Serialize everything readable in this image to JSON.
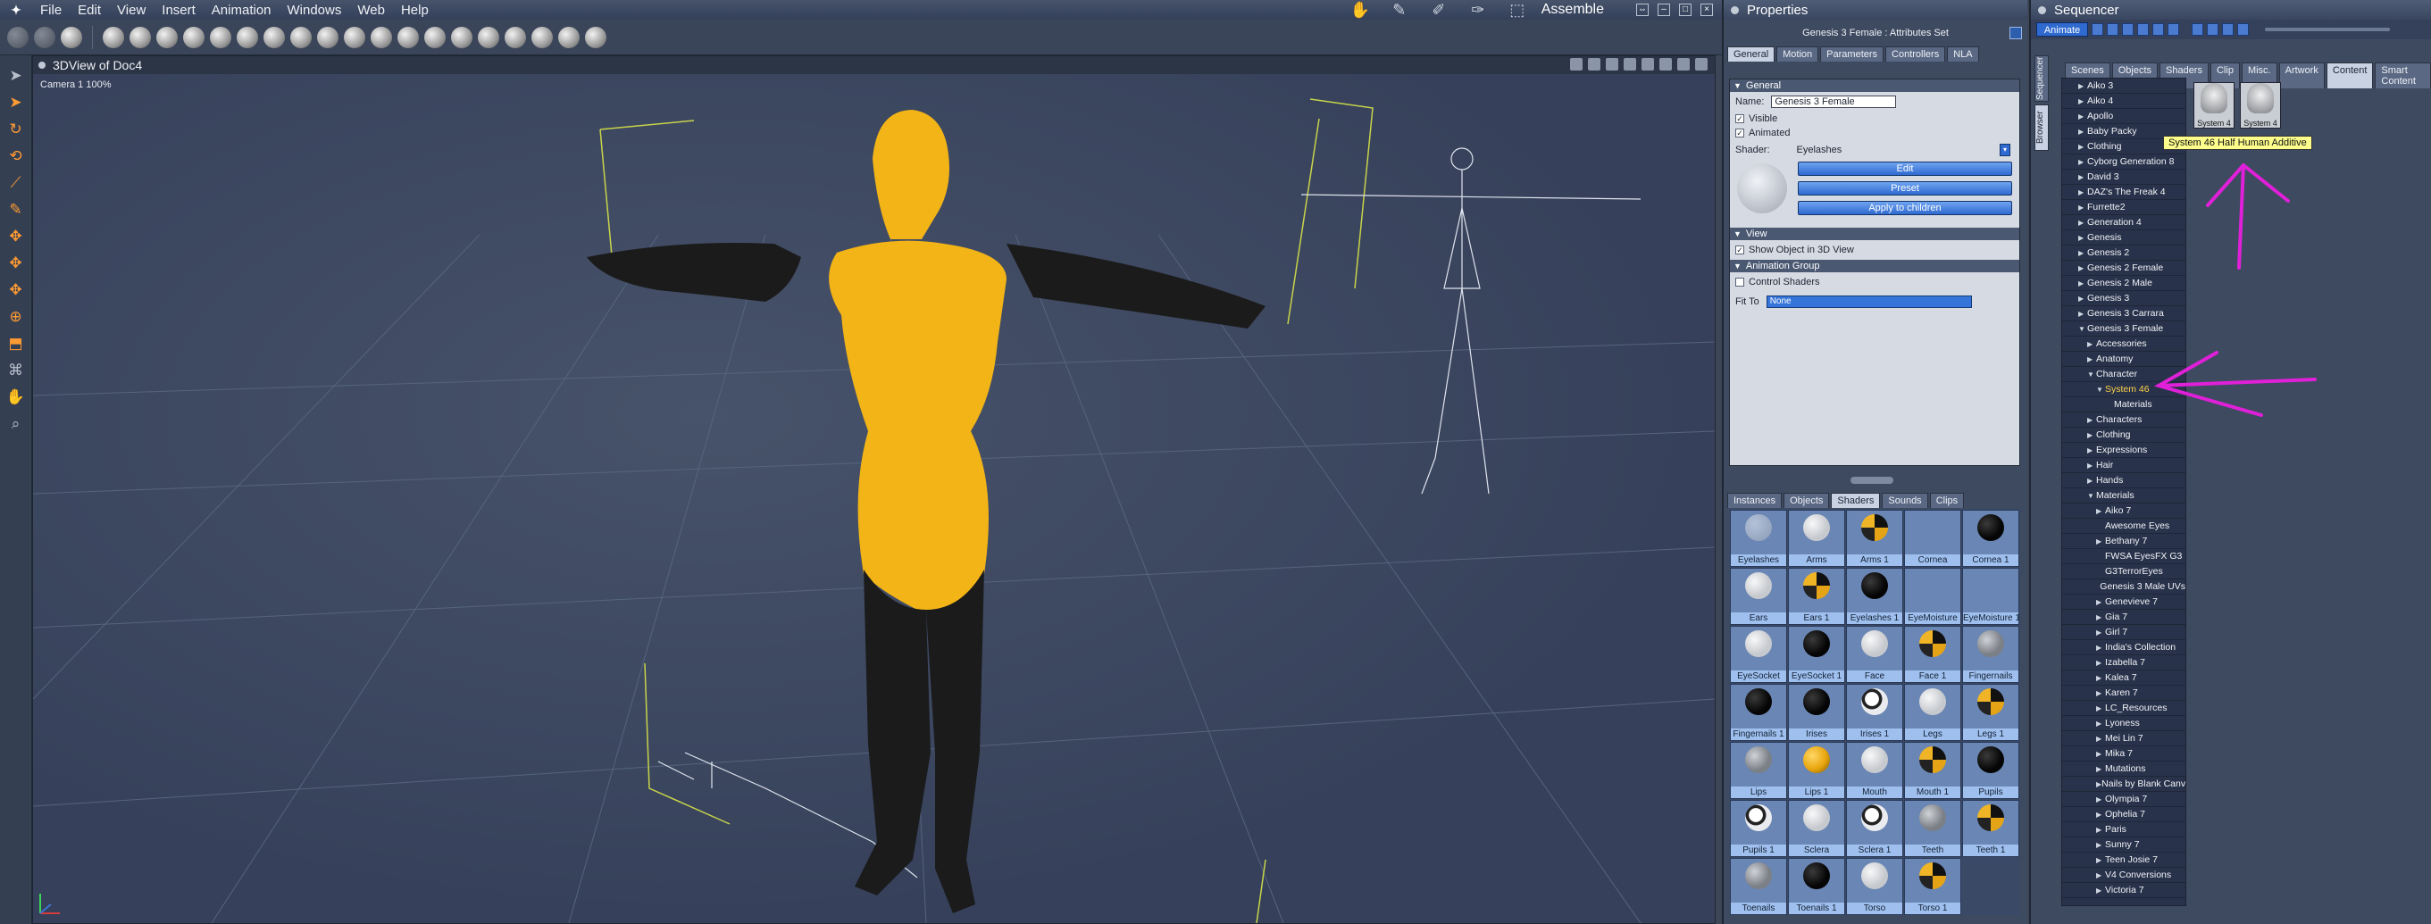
{
  "menubar": {
    "items": [
      "File",
      "Edit",
      "View",
      "Insert",
      "Animation",
      "Windows",
      "Web",
      "Help"
    ],
    "layout_name": "Assemble"
  },
  "viewport": {
    "title": "3DView of Doc4",
    "camera_label": "Camera 1 100%"
  },
  "properties": {
    "panel_title": "Properties",
    "subtitle": "Genesis 3 Female : Attributes Set",
    "tabs": [
      "General",
      "Motion",
      "Parameters",
      "Controllers",
      "NLA"
    ],
    "general_header": "General",
    "name_label": "Name:",
    "name_value": "Genesis 3 Female",
    "visible_label": "Visible",
    "animated_label": "Animated",
    "shader_label": "Shader:",
    "shader_value": "Eyelashes",
    "edit_label": "Edit",
    "preset_label": "Preset",
    "apply_label": "Apply to children",
    "view_header": "View",
    "show_label": "Show Object in 3D View",
    "anim_group_header": "Animation Group",
    "control_shaders_label": "Control Shaders",
    "fit_label": "Fit To",
    "fit_value": "None",
    "bottom_tabs": [
      "Instances",
      "Objects",
      "Shaders",
      "Sounds",
      "Clips"
    ],
    "shaders": [
      {
        "name": "Eyelashes",
        "ball": "faint"
      },
      {
        "name": "Arms",
        "ball": "pale"
      },
      {
        "name": "Arms 1",
        "ball": "mix"
      },
      {
        "name": "Cornea",
        "ball": "none"
      },
      {
        "name": "Cornea 1",
        "ball": "black"
      },
      {
        "name": "Ears",
        "ball": "pale"
      },
      {
        "name": "Ears 1",
        "ball": "mix"
      },
      {
        "name": "Eyelashes 1",
        "ball": "black"
      },
      {
        "name": "EyeMoisture",
        "ball": "none"
      },
      {
        "name": "EyeMoisture 1",
        "ball": "none"
      },
      {
        "name": "EyeSocket",
        "ball": "pale"
      },
      {
        "name": "EyeSocket 1",
        "ball": "black"
      },
      {
        "name": "Face",
        "ball": "pale"
      },
      {
        "name": "Face 1",
        "ball": "mix"
      },
      {
        "name": "Fingernails",
        "ball": "grey"
      },
      {
        "name": "Fingernails 1",
        "ball": "black"
      },
      {
        "name": "Irises",
        "ball": "black"
      },
      {
        "name": "Irises 1",
        "ball": "eye"
      },
      {
        "name": "Legs",
        "ball": "pale"
      },
      {
        "name": "Legs 1",
        "ball": "mix"
      },
      {
        "name": "Lips",
        "ball": "grey"
      },
      {
        "name": "Lips 1",
        "ball": "gold"
      },
      {
        "name": "Mouth",
        "ball": "pale"
      },
      {
        "name": "Mouth 1",
        "ball": "mix"
      },
      {
        "name": "Pupils",
        "ball": "black"
      },
      {
        "name": "Pupils 1",
        "ball": "eye"
      },
      {
        "name": "Sclera",
        "ball": "pale"
      },
      {
        "name": "Sclera 1",
        "ball": "eye"
      },
      {
        "name": "Teeth",
        "ball": "grey"
      },
      {
        "name": "Teeth 1",
        "ball": "mix"
      },
      {
        "name": "Toenails",
        "ball": "grey"
      },
      {
        "name": "Toenails 1",
        "ball": "black"
      },
      {
        "name": "Torso",
        "ball": "pale"
      },
      {
        "name": "Torso 1",
        "ball": "mix"
      }
    ]
  },
  "sequencer": {
    "panel_title": "Sequencer",
    "animate_label": "Animate",
    "vtabs": [
      "Sequencer",
      "Browser"
    ],
    "tabs": [
      "Scenes",
      "Objects",
      "Shaders",
      "Clip",
      "Misc.",
      "Artwork",
      "Content",
      "Smart Content"
    ],
    "tree": [
      {
        "label": "Aiko 3",
        "level": 0,
        "arrow": "▶"
      },
      {
        "label": "Aiko 4",
        "level": 0,
        "arrow": "▶"
      },
      {
        "label": "Apollo",
        "level": 0,
        "arrow": "▶"
      },
      {
        "label": "Baby Packy",
        "level": 0,
        "arrow": "▶"
      },
      {
        "label": "Clothing",
        "level": 0,
        "arrow": "▶"
      },
      {
        "label": "Cyborg Generation 8",
        "level": 0,
        "arrow": "▶"
      },
      {
        "label": "David 3",
        "level": 0,
        "arrow": "▶"
      },
      {
        "label": "DAZ's The Freak 4",
        "level": 0,
        "arrow": "▶"
      },
      {
        "label": "Furrette2",
        "level": 0,
        "arrow": "▶"
      },
      {
        "label": "Generation 4",
        "level": 0,
        "arrow": "▶"
      },
      {
        "label": "Genesis",
        "level": 0,
        "arrow": "▶"
      },
      {
        "label": "Genesis 2",
        "level": 0,
        "arrow": "▶"
      },
      {
        "label": "Genesis 2 Female",
        "level": 0,
        "arrow": "▶"
      },
      {
        "label": "Genesis 2 Male",
        "level": 0,
        "arrow": "▶"
      },
      {
        "label": "Genesis 3",
        "level": 0,
        "arrow": "▶"
      },
      {
        "label": "Genesis 3 Carrara",
        "level": 0,
        "arrow": "▶"
      },
      {
        "label": "Genesis 3 Female",
        "level": 0,
        "arrow": "▼"
      },
      {
        "label": "Accessories",
        "level": 1,
        "arrow": "▶"
      },
      {
        "label": "Anatomy",
        "level": 1,
        "arrow": "▶"
      },
      {
        "label": "Character",
        "level": 1,
        "arrow": "▼"
      },
      {
        "label": "System 46",
        "level": 2,
        "arrow": "▼",
        "sel": true
      },
      {
        "label": "Materials",
        "level": 3,
        "arrow": ""
      },
      {
        "label": "Characters",
        "level": 1,
        "arrow": "▶"
      },
      {
        "label": "Clothing",
        "level": 1,
        "arrow": "▶"
      },
      {
        "label": "Expressions",
        "level": 1,
        "arrow": "▶"
      },
      {
        "label": "Hair",
        "level": 1,
        "arrow": "▶"
      },
      {
        "label": "Hands",
        "level": 1,
        "arrow": "▶"
      },
      {
        "label": "Materials",
        "level": 1,
        "arrow": "▼"
      },
      {
        "label": "Aiko 7",
        "level": 2,
        "arrow": "▶"
      },
      {
        "label": "Awesome Eyes",
        "level": 2,
        "arrow": ""
      },
      {
        "label": "Bethany 7",
        "level": 2,
        "arrow": "▶"
      },
      {
        "label": "FWSA EyesFX G3",
        "level": 2,
        "arrow": ""
      },
      {
        "label": "G3TerrorEyes",
        "level": 2,
        "arrow": ""
      },
      {
        "label": "Genesis 3 Male UVs",
        "level": 2,
        "arrow": ""
      },
      {
        "label": "Genevieve 7",
        "level": 2,
        "arrow": "▶"
      },
      {
        "label": "Gia 7",
        "level": 2,
        "arrow": "▶"
      },
      {
        "label": "Girl 7",
        "level": 2,
        "arrow": "▶"
      },
      {
        "label": "India's Collection",
        "level": 2,
        "arrow": "▶"
      },
      {
        "label": "Izabella 7",
        "level": 2,
        "arrow": "▶"
      },
      {
        "label": "Kalea 7",
        "level": 2,
        "arrow": "▶"
      },
      {
        "label": "Karen 7",
        "level": 2,
        "arrow": "▶"
      },
      {
        "label": "LC_Resources",
        "level": 2,
        "arrow": "▶"
      },
      {
        "label": "Lyoness",
        "level": 2,
        "arrow": "▶"
      },
      {
        "label": "Mei Lin 7",
        "level": 2,
        "arrow": "▶"
      },
      {
        "label": "Mika 7",
        "level": 2,
        "arrow": "▶"
      },
      {
        "label": "Mutations",
        "level": 2,
        "arrow": "▶"
      },
      {
        "label": "Nails by Blank Canvas",
        "level": 2,
        "arrow": "▶"
      },
      {
        "label": "Olympia 7",
        "level": 2,
        "arrow": "▶"
      },
      {
        "label": "Ophelia 7",
        "level": 2,
        "arrow": "▶"
      },
      {
        "label": "Paris",
        "level": 2,
        "arrow": "▶"
      },
      {
        "label": "Sunny 7",
        "level": 2,
        "arrow": "▶"
      },
      {
        "label": "Teen Josie 7",
        "level": 2,
        "arrow": "▶"
      },
      {
        "label": "V4 Conversions",
        "level": 2,
        "arrow": "▶"
      },
      {
        "label": "Victoria 7",
        "level": 2,
        "arrow": "▶"
      }
    ],
    "thumbs": [
      "System 4",
      "System 4"
    ],
    "tooltip": "System 46 Half Human Additive"
  },
  "colors": {
    "annotation": "#e020d8",
    "figure_yellow": "#f2b416",
    "figure_black": "#1b1b1b"
  }
}
